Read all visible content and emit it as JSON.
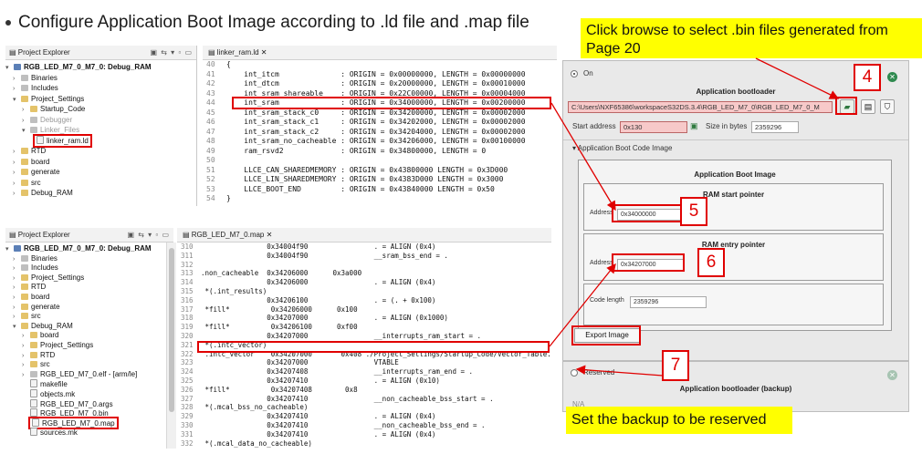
{
  "slide_title": "Configure Application Boot Image according to .ld file and .map file",
  "top_explorer": {
    "title": "Project Explorer",
    "items": [
      {
        "label": "RGB_LED_M7_0_M7_0: Debug_RAM"
      },
      {
        "label": "Binaries"
      },
      {
        "label": "Includes"
      },
      {
        "label": "Project_Settings"
      },
      {
        "label": "Startup_Code"
      },
      {
        "label": "Debugger"
      },
      {
        "label": "Linker_Files"
      },
      {
        "label": "linker_ram.ld"
      },
      {
        "label": "RTD"
      },
      {
        "label": "board"
      },
      {
        "label": "generate"
      },
      {
        "label": "src"
      },
      {
        "label": "Debug_RAM"
      }
    ]
  },
  "top_editor": {
    "tab": "linker_ram.ld",
    "lines": [
      {
        "n": "40",
        "t": "{"
      },
      {
        "n": "41",
        "t": "    int_itcm              : ORIGIN = 0x00000000, LENGTH = 0x00000000"
      },
      {
        "n": "42",
        "t": "    int_dtcm              : ORIGIN = 0x20000000, LENGTH = 0x00010000"
      },
      {
        "n": "43",
        "t": "    int_sram_shareable    : ORIGIN = 0x22C00000, LENGTH = 0x00004000"
      },
      {
        "n": "44",
        "t": "    int_sram              : ORIGIN = 0x34000000, LENGTH = 0x00200000"
      },
      {
        "n": "45",
        "t": "    int_sram_stack_c0     : ORIGIN = 0x34200000, LENGTH = 0x00002000"
      },
      {
        "n": "46",
        "t": "    int_sram_stack_c1     : ORIGIN = 0x34202000, LENGTH = 0x00002000"
      },
      {
        "n": "47",
        "t": "    int_sram_stack_c2     : ORIGIN = 0x34204000, LENGTH = 0x00002000"
      },
      {
        "n": "48",
        "t": "    int_sram_no_cacheable : ORIGIN = 0x34206000, LENGTH = 0x00100000"
      },
      {
        "n": "49",
        "t": "    ram_rsvd2             : ORIGIN = 0x34800000, LENGTH = 0"
      },
      {
        "n": "50",
        "t": ""
      },
      {
        "n": "51",
        "t": "    LLCE_CAN_SHAREDMEMORY : ORIGIN = 0x43800000 LENGTH = 0x3D000"
      },
      {
        "n": "52",
        "t": "    LLCE_LIN_SHAREDMEMORY : ORIGIN = 0x4383D000 LENGTH = 0x3000"
      },
      {
        "n": "53",
        "t": "    LLCE_BOOT_END         : ORIGIN = 0x43840000 LENGTH = 0x50"
      },
      {
        "n": "54",
        "t": "}"
      }
    ]
  },
  "bottom_explorer": {
    "title": "Project Explorer",
    "items": [
      {
        "label": "RGB_LED_M7_0_M7_0: Debug_RAM"
      },
      {
        "label": "Binaries"
      },
      {
        "label": "Includes"
      },
      {
        "label": "Project_Settings"
      },
      {
        "label": "RTD"
      },
      {
        "label": "board"
      },
      {
        "label": "generate"
      },
      {
        "label": "src"
      },
      {
        "label": "Debug_RAM"
      },
      {
        "label": "board"
      },
      {
        "label": "Project_Settings"
      },
      {
        "label": "RTD"
      },
      {
        "label": "src"
      },
      {
        "label": "RGB_LED_M7_0.elf - [arm/le]"
      },
      {
        "label": "makefile"
      },
      {
        "label": "objects.mk"
      },
      {
        "label": "RGB_LED_M7_0.args"
      },
      {
        "label": "RGB_LED_M7_0.bin"
      },
      {
        "label": "RGB_LED_M7_0.map"
      },
      {
        "label": "sources.mk"
      }
    ]
  },
  "bottom_editor": {
    "tab": "RGB_LED_M7_0.map",
    "lines": [
      {
        "n": "310",
        "t": "                0x34004f90                . = ALIGN (0x4)"
      },
      {
        "n": "311",
        "t": "                0x34004f90                __sram_bss_end = ."
      },
      {
        "n": "312",
        "t": ""
      },
      {
        "n": "313",
        "t": ".non_cacheable  0x34206000      0x3a000"
      },
      {
        "n": "314",
        "t": "                0x34206000                . = ALIGN (0x4)"
      },
      {
        "n": "315",
        "t": " *(.int_results)"
      },
      {
        "n": "316",
        "t": "                0x34206100                . = (. + 0x100)"
      },
      {
        "n": "317",
        "t": " *fill*          0x34206000      0x100"
      },
      {
        "n": "318",
        "t": "                0x34207000                . = ALIGN (0x1000)"
      },
      {
        "n": "319",
        "t": " *fill*          0x34206100      0xf00"
      },
      {
        "n": "320",
        "t": "                0x34207000                __interrupts_ram_start = ."
      },
      {
        "n": "321",
        "t": " *(.intc_vector)"
      },
      {
        "n": "322",
        "t": " .intc_vector    0x34207000       0x408 ./Project_Settings/Startup_Code/Vector_Table.o"
      },
      {
        "n": "323",
        "t": "                0x34207000                VTABLE"
      },
      {
        "n": "324",
        "t": "                0x34207408                __interrupts_ram_end = ."
      },
      {
        "n": "325",
        "t": "                0x34207410                . = ALIGN (0x10)"
      },
      {
        "n": "326",
        "t": " *fill*          0x34207408        0x8"
      },
      {
        "n": "327",
        "t": "                0x34207410                __non_cacheable_bss_start = ."
      },
      {
        "n": "328",
        "t": " *(.mcal_bss_no_cacheable)"
      },
      {
        "n": "329",
        "t": "                0x34207410                . = ALIGN (0x4)"
      },
      {
        "n": "330",
        "t": "                0x34207410                __non_cacheable_bss_end = ."
      },
      {
        "n": "331",
        "t": "                0x34207410                . = ALIGN (0x4)"
      },
      {
        "n": "332",
        "t": " *(.mcal_data_no_cacheable)"
      }
    ]
  },
  "config": {
    "on_label": "On",
    "app_bootloader_title": "Application bootloader",
    "path_value": "C:\\Users\\NXF65386\\workspaceS32DS.3.4\\RGB_LED_M7_0\\RGB_LED_M7_0_M",
    "start_address_label": "Start address",
    "start_address_value": "0x130",
    "size_label": "Size in bytes",
    "size_value": "2359296",
    "section_title": "Application Boot Code Image",
    "boot_image_title": "Application Boot Image",
    "ram_start_title": "RAM start pointer",
    "address_label": "Address",
    "ram_start_value": "0x34000000",
    "ram_entry_title": "RAM entry pointer",
    "ram_entry_value": "0x34207000",
    "code_length_label": "Code length",
    "code_length_value": "2359296",
    "export_button": "Export Image",
    "reserved_label": "Reserved",
    "backup_title": "Application bootloader (backup)",
    "backup_path_partial": "N/A"
  },
  "callouts": {
    "browse": "Click browse to select .bin files generated from Page 20",
    "backup": "Set the backup to be reserved"
  },
  "steps": {
    "s4": "4",
    "s5": "5",
    "s6": "6",
    "s7": "7"
  },
  "colors": {
    "highlight": "#e00000",
    "callout": "#ffff00",
    "close_green": "#2f8a4f"
  }
}
